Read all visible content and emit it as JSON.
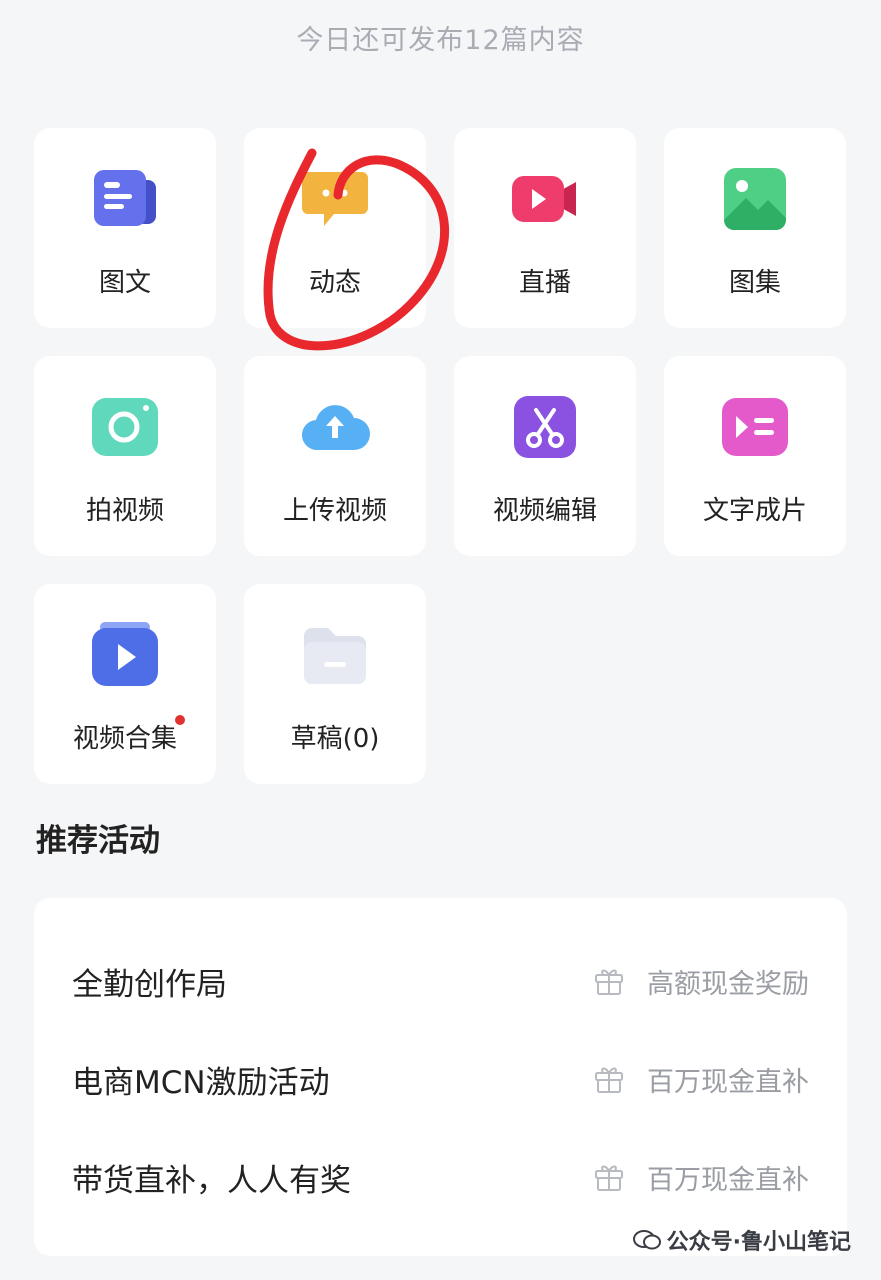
{
  "header": {
    "quota_text": "今日还可发布12篇内容"
  },
  "tiles": [
    {
      "label": "图文",
      "icon": "article-icon",
      "color": "#5a63e0"
    },
    {
      "label": "动态",
      "icon": "chat-bubble-icon",
      "color": "#f4b23d"
    },
    {
      "label": "直播",
      "icon": "live-camera-icon",
      "color": "#ec3c6a"
    },
    {
      "label": "图集",
      "icon": "image-gallery-icon",
      "color": "#3ec27a"
    },
    {
      "label": "拍视频",
      "icon": "camera-icon",
      "color": "#4fd1b4"
    },
    {
      "label": "上传视频",
      "icon": "cloud-upload-icon",
      "color": "#4aa4f3"
    },
    {
      "label": "视频编辑",
      "icon": "scissors-icon",
      "color": "#8a4fe0"
    },
    {
      "label": "文字成片",
      "icon": "text-to-video-icon",
      "color": "#e050c8"
    },
    {
      "label": "视频合集",
      "icon": "video-collection-icon",
      "color": "#4a6ae8"
    },
    {
      "label": "草稿(0)",
      "icon": "folder-icon",
      "color": "#d5d9e6"
    }
  ],
  "section": {
    "title": "推荐活动"
  },
  "activities": [
    {
      "name": "全勤创作局",
      "reward": "高额现金奖励"
    },
    {
      "name": "电商MCN激励活动",
      "reward": "百万现金直补"
    },
    {
      "name": "带货直补，人人有奖",
      "reward": "百万现金直补"
    }
  ],
  "watermark": {
    "text": "公众号·鲁小山笔记"
  }
}
